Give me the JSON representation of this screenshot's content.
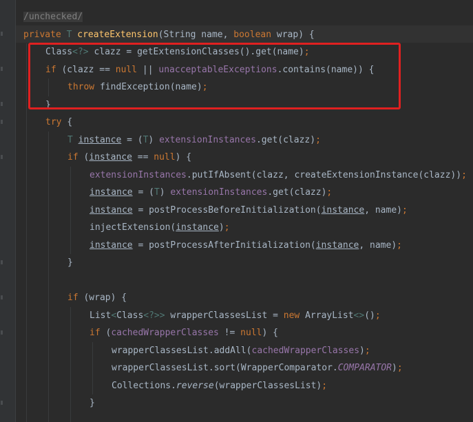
{
  "editor": {
    "highlight_color": "#e02020",
    "background": "#2b2b2b"
  },
  "lines": [
    {
      "tokens": [
        {
          "t": "/unchecked/",
          "c": "comment"
        }
      ]
    },
    {
      "tokens": [
        {
          "t": "private ",
          "c": "kw"
        },
        {
          "t": "T ",
          "c": "type-param"
        },
        {
          "t": "createExtension",
          "c": "fn"
        },
        {
          "t": "(String name, ",
          "c": "punct"
        },
        {
          "t": "boolean ",
          "c": "kw"
        },
        {
          "t": "wrap) {",
          "c": "punct"
        }
      ]
    },
    {
      "tokens": [
        {
          "t": "Class",
          "c": "punct"
        },
        {
          "t": "<?>",
          "c": "type-param"
        },
        {
          "t": " clazz = getExtensionClasses().get(name)",
          "c": "punct"
        },
        {
          "t": ";",
          "c": "semi"
        }
      ]
    },
    {
      "tokens": [
        {
          "t": "if ",
          "c": "kw"
        },
        {
          "t": "(clazz == ",
          "c": "punct"
        },
        {
          "t": "null ",
          "c": "kw"
        },
        {
          "t": "|| ",
          "c": "punct"
        },
        {
          "t": "unacceptableExceptions",
          "c": "field"
        },
        {
          "t": ".contains(name)) {",
          "c": "punct"
        }
      ]
    },
    {
      "tokens": [
        {
          "t": "throw ",
          "c": "kw"
        },
        {
          "t": "findException(name)",
          "c": "punct"
        },
        {
          "t": ";",
          "c": "semi"
        }
      ]
    },
    {
      "tokens": [
        {
          "t": "}",
          "c": "punct"
        }
      ]
    },
    {
      "tokens": [
        {
          "t": "try ",
          "c": "kw"
        },
        {
          "t": "{",
          "c": "punct"
        }
      ]
    },
    {
      "tokens": [
        {
          "t": "T ",
          "c": "type-param"
        },
        {
          "t": "instance",
          "c": "local"
        },
        {
          "t": " = (",
          "c": "punct"
        },
        {
          "t": "T",
          "c": "type-param"
        },
        {
          "t": ") ",
          "c": "punct"
        },
        {
          "t": "extensionInstances",
          "c": "field"
        },
        {
          "t": ".get(clazz)",
          "c": "punct"
        },
        {
          "t": ";",
          "c": "semi"
        }
      ]
    },
    {
      "tokens": [
        {
          "t": "if ",
          "c": "kw"
        },
        {
          "t": "(",
          "c": "punct"
        },
        {
          "t": "instance",
          "c": "local"
        },
        {
          "t": " == ",
          "c": "punct"
        },
        {
          "t": "null",
          "c": "kw"
        },
        {
          "t": ") {",
          "c": "punct"
        }
      ]
    },
    {
      "tokens": [
        {
          "t": "extensionInstances",
          "c": "field"
        },
        {
          "t": ".putIfAbsent(clazz, ",
          "c": "punct"
        },
        {
          "t": "createExtensionInstance(clazz))",
          "c": "punct"
        },
        {
          "t": ";",
          "c": "semi"
        }
      ]
    },
    {
      "tokens": [
        {
          "t": "instance",
          "c": "local"
        },
        {
          "t": " = (",
          "c": "punct"
        },
        {
          "t": "T",
          "c": "type-param"
        },
        {
          "t": ") ",
          "c": "punct"
        },
        {
          "t": "extensionInstances",
          "c": "field"
        },
        {
          "t": ".get(clazz)",
          "c": "punct"
        },
        {
          "t": ";",
          "c": "semi"
        }
      ]
    },
    {
      "tokens": [
        {
          "t": "instance",
          "c": "local"
        },
        {
          "t": " = postProcessBeforeInitialization(",
          "c": "punct"
        },
        {
          "t": "instance",
          "c": "local"
        },
        {
          "t": ", name)",
          "c": "punct"
        },
        {
          "t": ";",
          "c": "semi"
        }
      ]
    },
    {
      "tokens": [
        {
          "t": "injectExtension(",
          "c": "punct"
        },
        {
          "t": "instance",
          "c": "local"
        },
        {
          "t": ")",
          "c": "punct"
        },
        {
          "t": ";",
          "c": "semi"
        }
      ]
    },
    {
      "tokens": [
        {
          "t": "instance",
          "c": "local"
        },
        {
          "t": " = postProcessAfterInitialization(",
          "c": "punct"
        },
        {
          "t": "instance",
          "c": "local"
        },
        {
          "t": ", name)",
          "c": "punct"
        },
        {
          "t": ";",
          "c": "semi"
        }
      ]
    },
    {
      "tokens": [
        {
          "t": "}",
          "c": "punct"
        }
      ]
    },
    {
      "tokens": []
    },
    {
      "tokens": [
        {
          "t": "if ",
          "c": "kw"
        },
        {
          "t": "(wrap) {",
          "c": "punct"
        }
      ]
    },
    {
      "tokens": [
        {
          "t": "List",
          "c": "punct"
        },
        {
          "t": "<",
          "c": "type-param"
        },
        {
          "t": "Class",
          "c": "punct"
        },
        {
          "t": "<?>>",
          "c": "type-param"
        },
        {
          "t": " wrapperClassesList = ",
          "c": "punct"
        },
        {
          "t": "new ",
          "c": "kw"
        },
        {
          "t": "ArrayList",
          "c": "punct"
        },
        {
          "t": "<>",
          "c": "type-param"
        },
        {
          "t": "()",
          "c": "punct"
        },
        {
          "t": ";",
          "c": "semi"
        }
      ]
    },
    {
      "tokens": [
        {
          "t": "if ",
          "c": "kw"
        },
        {
          "t": "(",
          "c": "punct"
        },
        {
          "t": "cachedWrapperClasses",
          "c": "field"
        },
        {
          "t": " != ",
          "c": "punct"
        },
        {
          "t": "null",
          "c": "kw"
        },
        {
          "t": ") {",
          "c": "punct"
        }
      ]
    },
    {
      "tokens": [
        {
          "t": "wrapperClassesList.addAll(",
          "c": "punct"
        },
        {
          "t": "cachedWrapperClasses",
          "c": "field"
        },
        {
          "t": ")",
          "c": "punct"
        },
        {
          "t": ";",
          "c": "semi"
        }
      ]
    },
    {
      "tokens": [
        {
          "t": "wrapperClassesList.sort(WrapperComparator.",
          "c": "punct"
        },
        {
          "t": "COMPARATOR",
          "c": "italic-static"
        },
        {
          "t": ")",
          "c": "punct"
        },
        {
          "t": ";",
          "c": "semi"
        }
      ]
    },
    {
      "tokens": [
        {
          "t": "Collections.",
          "c": "punct"
        },
        {
          "t": "reverse",
          "c": "italic-method"
        },
        {
          "t": "(wrapperClassesList)",
          "c": "punct"
        },
        {
          "t": ";",
          "c": "semi"
        }
      ]
    },
    {
      "tokens": [
        {
          "t": "}",
          "c": "punct"
        }
      ]
    },
    {
      "tokens": []
    }
  ]
}
